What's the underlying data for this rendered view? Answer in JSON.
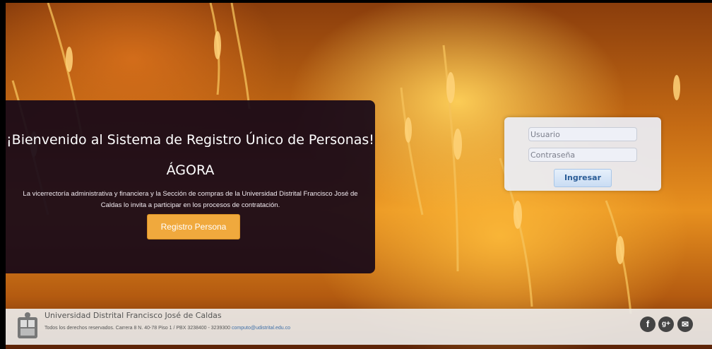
{
  "welcome": {
    "title_line1": "¡Bienvenido al Sistema de Registro Único de Personas!",
    "title_line2": "ÁGORA",
    "description": "La vicerrectoría administrativa y financiera y la Sección de compras de la Universidad Distrital Francisco José de Caldas lo invita a participar en los procesos de contratación.",
    "register_button": "Registro Persona"
  },
  "login": {
    "user_placeholder": "Usuario",
    "password_placeholder": "Contraseña",
    "submit_label": "Ingresar"
  },
  "footer": {
    "university": "Universidad Distrital Francisco José de Caldas",
    "rights": "Todos los derechos reservados. Carrera 8 N. 40-78 Piso 1 / PBX 3238400 - 3239300",
    "email": "computo@udistrital.edu.co",
    "social": [
      {
        "icon": "facebook-icon",
        "glyph": "f"
      },
      {
        "icon": "google-plus-icon",
        "glyph": "g+"
      },
      {
        "icon": "mail-icon",
        "glyph": "✉"
      }
    ]
  },
  "colors": {
    "accent": "#f0a93d",
    "panel": "#160818",
    "link": "#3f6fa8"
  }
}
